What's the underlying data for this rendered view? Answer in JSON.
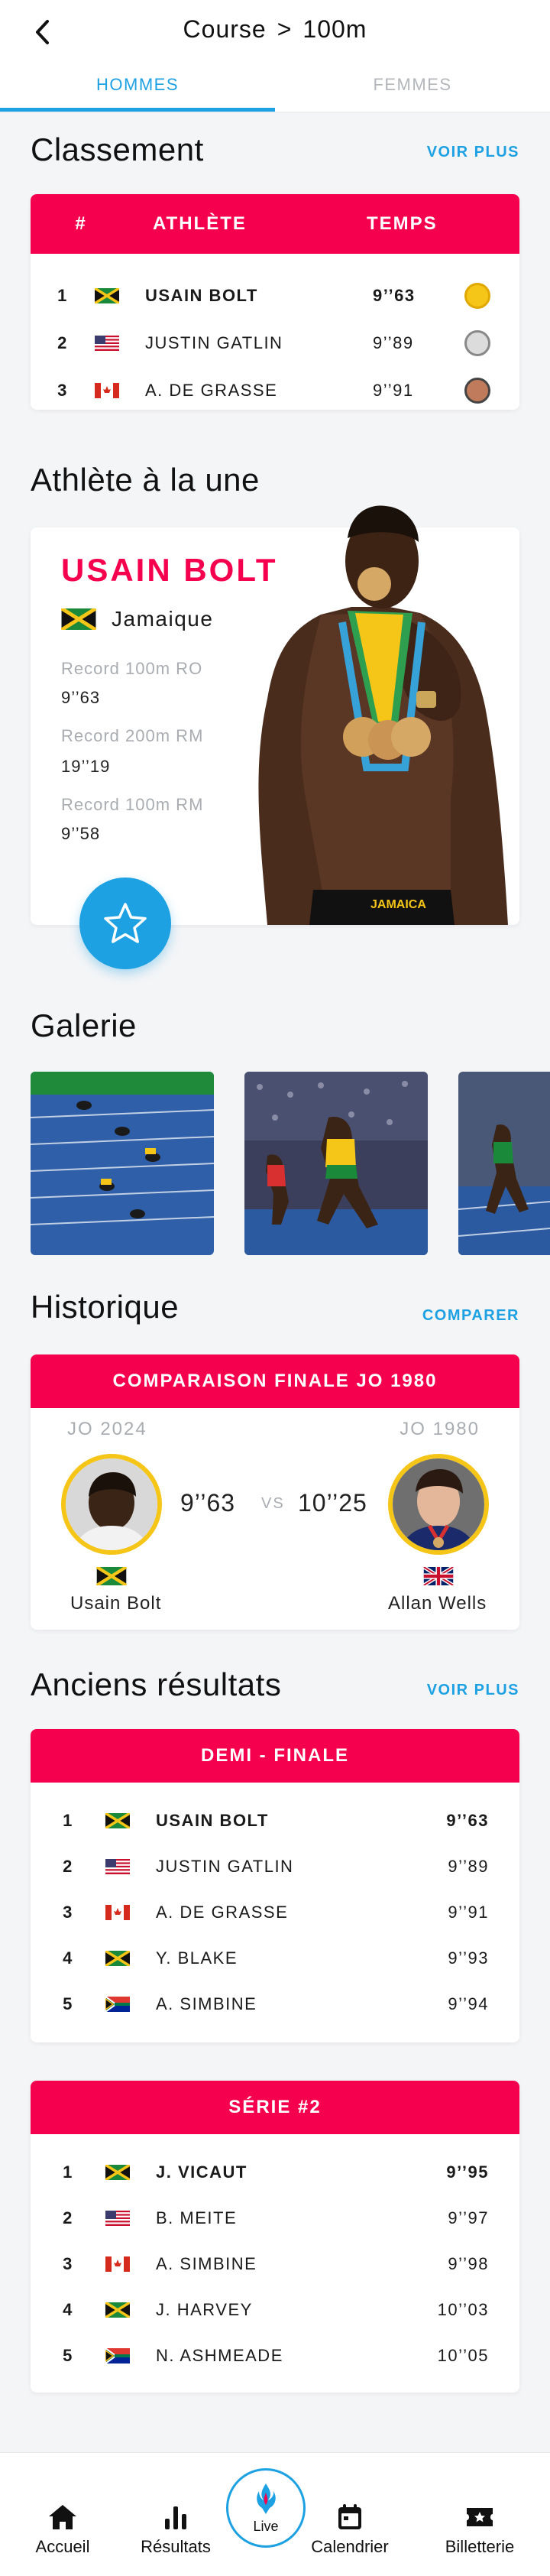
{
  "header": {
    "crumb_sport": "Course",
    "crumb_separator": ">",
    "crumb_event": "100m",
    "tabs": [
      {
        "label": "HOMMES",
        "active": true
      },
      {
        "label": "FEMMES",
        "active": false
      }
    ]
  },
  "colors": {
    "accent": "#1da1e2",
    "brand": "#f5004f",
    "gold": "#f5c518",
    "silver": "#c8c8c8",
    "bronze": "#c07a5c"
  },
  "classement": {
    "title": "Classement",
    "link": "VOIR PLUS",
    "columns": [
      "#",
      "ATHLÈTE",
      "TEMPS"
    ],
    "rows": [
      {
        "rank": "1",
        "flag": "jamaica",
        "name": "USAIN BOLT",
        "time": "9’’63",
        "medal": "gold"
      },
      {
        "rank": "2",
        "flag": "usa",
        "name": "JUSTIN GATLIN",
        "time": "9’’89",
        "medal": "silver"
      },
      {
        "rank": "3",
        "flag": "canada",
        "name": "A. DE GRASSE",
        "time": "9’’91",
        "medal": "bronze"
      }
    ]
  },
  "featured": {
    "title": "Athlète à la une",
    "name": "USAIN BOLT",
    "country": "Jamaique",
    "records": [
      {
        "label": "Record 100m RO",
        "value": "9’’63"
      },
      {
        "label": "Record 200m RM",
        "value": "19’’19"
      },
      {
        "label": "Record 100m RM",
        "value": "9’’58"
      }
    ],
    "favorite_icon": "star-icon",
    "shorts_text": "JAMAICA"
  },
  "gallery": {
    "title": "Galerie"
  },
  "historique": {
    "title": "Historique",
    "link": "COMPARER",
    "header": "COMPARAISON FINALE JO 1980",
    "left": {
      "games": "JO 2024",
      "time": "9’’63",
      "name": "Usain Bolt",
      "flag": "jamaica"
    },
    "vs": "VS",
    "right": {
      "games": "JO 1980",
      "time": "10’’25",
      "name": "Allan Wells",
      "flag": "uk"
    }
  },
  "anciens": {
    "title": "Anciens résultats",
    "link": "VOIR PLUS",
    "tables": [
      {
        "header": "DEMI - FINALE",
        "rows": [
          {
            "rank": "1",
            "flag": "jamaica",
            "name": "USAIN BOLT",
            "time": "9’’63"
          },
          {
            "rank": "2",
            "flag": "usa",
            "name": "JUSTIN GATLIN",
            "time": "9’’89"
          },
          {
            "rank": "3",
            "flag": "canada",
            "name": "A. DE GRASSE",
            "time": "9’’91"
          },
          {
            "rank": "4",
            "flag": "jamaica",
            "name": "Y. BLAKE",
            "time": "9’’93"
          },
          {
            "rank": "5",
            "flag": "southafrica",
            "name": "A. SIMBINE",
            "time": "9’’94"
          }
        ]
      },
      {
        "header": "SÉRIE #2",
        "rows": [
          {
            "rank": "1",
            "flag": "jamaica",
            "name": "J. VICAUT",
            "time": "9’’95"
          },
          {
            "rank": "2",
            "flag": "usa",
            "name": "B. MEITE",
            "time": "9’’97"
          },
          {
            "rank": "3",
            "flag": "canada",
            "name": "A. SIMBINE",
            "time": "9’’98"
          },
          {
            "rank": "4",
            "flag": "jamaica",
            "name": "J. HARVEY",
            "time": "10’’03"
          },
          {
            "rank": "5",
            "flag": "southafrica",
            "name": "N. ASHMEADE",
            "time": "10’’05"
          }
        ]
      }
    ]
  },
  "nav": {
    "items": [
      {
        "label": "Accueil",
        "icon": "home-icon"
      },
      {
        "label": "Résultats",
        "icon": "bar-chart-icon"
      },
      {
        "label": "Live",
        "icon": "torch-logo-icon"
      },
      {
        "label": "Calendrier",
        "icon": "calendar-icon"
      },
      {
        "label": "Billetterie",
        "icon": "ticket-icon"
      }
    ]
  }
}
